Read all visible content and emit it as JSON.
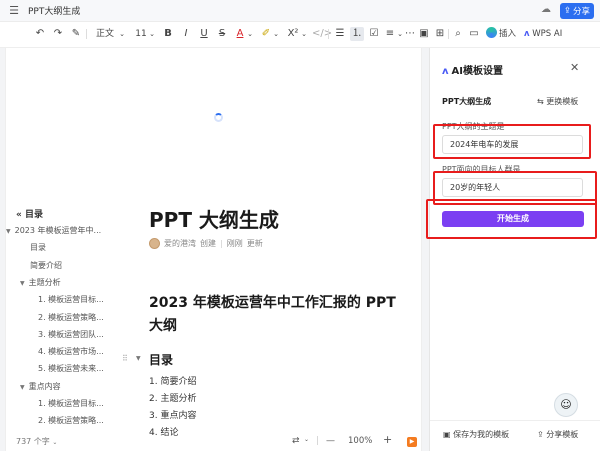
{
  "window": {
    "title": "PPT大纲生成",
    "share_label": "分享",
    "share_icon": "share-icon"
  },
  "toolbar": {
    "font_family": "正文",
    "font_size": "11",
    "insert_label": "插入",
    "wps_ai_label": "WPS AI"
  },
  "outline": {
    "title": "目录",
    "items": [
      {
        "label": "2023 年模板运营年中...",
        "level": 0,
        "collapsible": true
      },
      {
        "label": "目录",
        "level": 1,
        "collapsible": false
      },
      {
        "label": "简要介绍",
        "level": 1,
        "collapsible": false
      },
      {
        "label": "主题分析",
        "level": 1,
        "collapsible": true
      },
      {
        "label": "1. 模板运营目标...",
        "level": 2,
        "collapsible": false
      },
      {
        "label": "2. 模板运营策略...",
        "level": 2,
        "collapsible": false
      },
      {
        "label": "3. 模板运营团队...",
        "level": 2,
        "collapsible": false
      },
      {
        "label": "4. 模板运营市场...",
        "level": 2,
        "collapsible": false
      },
      {
        "label": "5. 模板运营未来...",
        "level": 2,
        "collapsible": false
      },
      {
        "label": "重点内容",
        "level": 1,
        "collapsible": true
      },
      {
        "label": "1. 模板运营目标...",
        "level": 2,
        "collapsible": false
      },
      {
        "label": "2. 模板运营策略...",
        "level": 2,
        "collapsible": false
      }
    ],
    "word_count": "737 个字"
  },
  "document": {
    "title": "PPT 大纲生成",
    "author": "爱的港湾",
    "created_label": "创建",
    "updated_time": "刚刚",
    "updated_label": "更新",
    "heading2": "2023 年模板运营年中工作汇报的 PPT 大纲",
    "heading3": "目录",
    "list": [
      "1.  简要介绍",
      "2.  主题分析",
      "3.  重点内容",
      "4.  结论"
    ]
  },
  "statusbar": {
    "zoom": "100%",
    "zoom_out": "—",
    "zoom_in": "+"
  },
  "panel": {
    "title": "AI模板设置",
    "template_name": "PPT大纲生成",
    "switch_template": "更换模板",
    "topic_label": "PPT大纲的主题是",
    "topic_value": "2024年电车的发展",
    "audience_label": "PPT面向的目标人群是",
    "audience_value": "20岁的年轻人",
    "generate_label": "开始生成",
    "save_as_template": "保存为我的模板",
    "share_template": "分享模板",
    "accent_color": "#7b3ff2",
    "highlight_color": "#e81c1c"
  }
}
